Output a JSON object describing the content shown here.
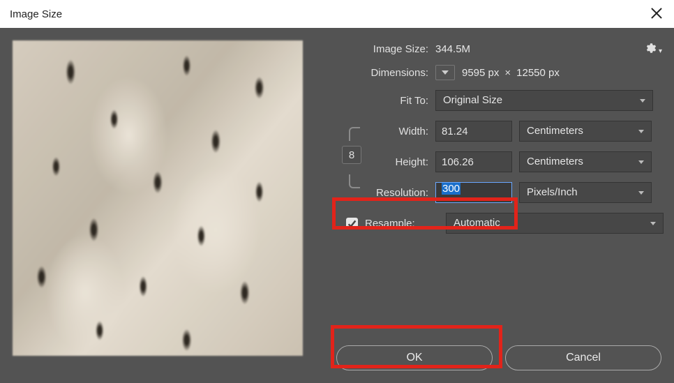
{
  "window": {
    "title": "Image Size"
  },
  "labels": {
    "image_size": "Image Size:",
    "dimensions": "Dimensions:",
    "fit_to": "Fit To:",
    "width": "Width:",
    "height": "Height:",
    "resolution": "Resolution:",
    "resample": "Resample:"
  },
  "values": {
    "image_size": "344.5M",
    "dim_w": "9595 px",
    "dim_h": "12550 px",
    "fit_to": "Original Size",
    "width": "81.24",
    "height": "106.26",
    "resolution": "300",
    "width_unit": "Centimeters",
    "height_unit": "Centimeters",
    "resolution_unit": "Pixels/Inch",
    "resample_mode": "Automatic"
  },
  "buttons": {
    "ok": "OK",
    "cancel": "Cancel"
  },
  "icons": {
    "link": "8"
  }
}
